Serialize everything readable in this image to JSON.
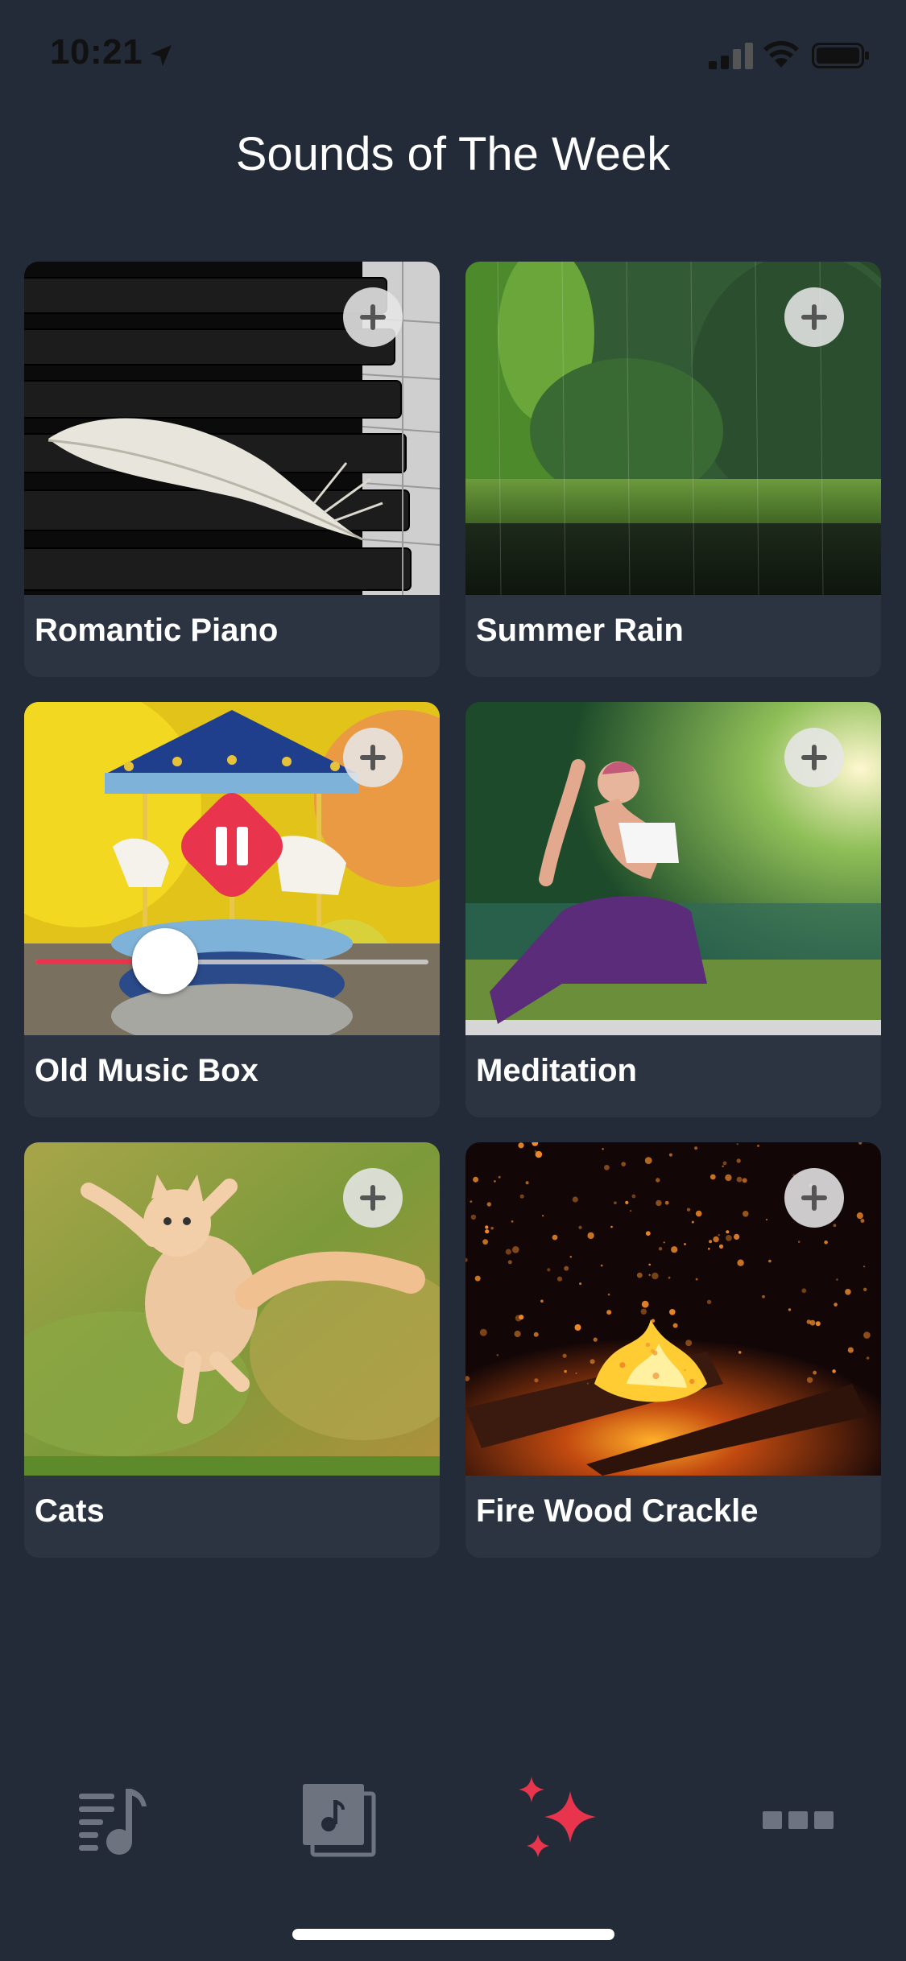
{
  "status_bar": {
    "time": "10:21"
  },
  "header": {
    "title": "Sounds of The Week"
  },
  "sounds": [
    {
      "title": "Romantic Piano",
      "image": "piano-feather-image"
    },
    {
      "title": "Summer Rain",
      "image": "forest-rain-image"
    },
    {
      "title": "Old Music Box",
      "image": "carousel-music-box-image",
      "playing": true,
      "progress": 0.33
    },
    {
      "title": "Meditation",
      "image": "yoga-meditation-image"
    },
    {
      "title": "Cats",
      "image": "jumping-cat-image"
    },
    {
      "title": "Fire Wood Crackle",
      "image": "campfire-sparks-image"
    }
  ],
  "tab_bar": {
    "items": [
      {
        "icon": "playlist-icon",
        "selected": false
      },
      {
        "icon": "music-library-icon",
        "selected": false
      },
      {
        "icon": "sparkles-icon",
        "selected": true
      },
      {
        "icon": "more-icon",
        "selected": false
      }
    ]
  },
  "colors": {
    "background": "#232b38",
    "card": "#2c3442",
    "accent": "#e8354d",
    "inactive_icon": "#6d7480"
  }
}
